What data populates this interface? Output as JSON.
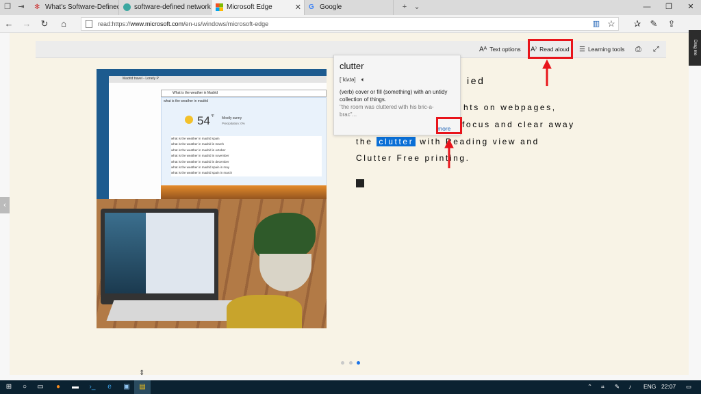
{
  "tabs": [
    {
      "label": "What's Software-Defined Ne",
      "active": false
    },
    {
      "label": "software-defined networkin",
      "active": false
    },
    {
      "label": "Microsoft Edge",
      "active": true
    },
    {
      "label": "Google",
      "active": false
    }
  ],
  "address": {
    "prefix": "read:https://",
    "host": "www.microsoft.com",
    "path": "/en-us/windows/microsoft-edge"
  },
  "toolbar": {
    "text_options": "Text options",
    "read_aloud": "Read aloud",
    "learning_tools": "Learning tools"
  },
  "hero": {
    "search_query": "What is the weather in Madrid",
    "suggestions": [
      "what is the weather in madrid",
      "what is the weather in madrid spain",
      "what is the weather in madrid in march",
      "what is the weather in madrid in october",
      "what is the weather in madrid in november",
      "what is the weather in madrid in december",
      "what is the weather in madrid spain in may",
      "what is the weather in madrid spain in march"
    ],
    "weather": {
      "temp": "54",
      "unit": "°F",
      "desc": "Mostly sunny",
      "precip": "Precipitation: 0%"
    },
    "tab_title": "Madrid travel - Lonely P"
  },
  "article": {
    "heading_fragment": "ied",
    "line1_fragment": "hts  on  webpages,",
    "line2_fragment": "focus  and  clear  away",
    "line3_a": "the",
    "line3_word": "clutter",
    "line3_b": "with  Reading  view  and",
    "line4": "Clutter  Free  printing."
  },
  "dictionary": {
    "word": "clutter",
    "pronunciation": "[ˈklʌtə]",
    "definition": "(verb) cover or fill (something) with an untidy collection of things.",
    "example": "\"the room was cluttered with his bric-a-brac\"...",
    "more": "more"
  },
  "drag_label": "Drag me",
  "taskbar": {
    "lang": "ENG",
    "time": "22:07"
  },
  "colors": {
    "highlight": "#e8141b",
    "selection": "#0a6fd6",
    "reading_bg": "#f8f3e6",
    "taskbar_bg": "#0b2231"
  }
}
